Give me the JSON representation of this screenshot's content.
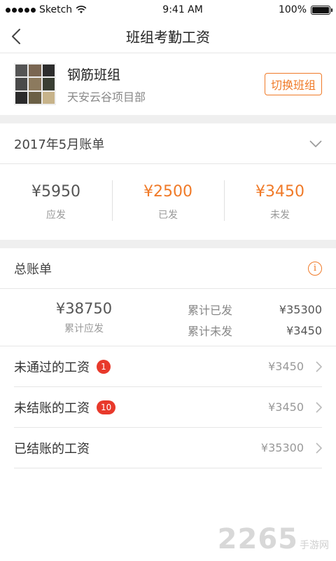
{
  "status": {
    "carrier": "Sketch",
    "time": "9:41 AM",
    "battery": "100%"
  },
  "nav": {
    "title": "班组考勤工资"
  },
  "team": {
    "name": "钢筋班组",
    "project": "天安云谷项目部",
    "switch_label": "切换班组"
  },
  "month": {
    "label": "2017年5月账单"
  },
  "stats": [
    {
      "value": "¥5950",
      "label": "应发",
      "color": "#555555"
    },
    {
      "value": "¥2500",
      "label": "已发",
      "color": "#f07a28"
    },
    {
      "value": "¥3450",
      "label": "未发",
      "color": "#f07a28"
    }
  ],
  "total": {
    "title": "总账单",
    "amount": "¥38750",
    "amount_label": "累计应发",
    "paid_label": "累计已发",
    "paid_value": "¥35300",
    "unpaid_label": "累计未发",
    "unpaid_value": "¥3450"
  },
  "list": [
    {
      "label": "未通过的工资",
      "badge": "1",
      "amount": "¥3450"
    },
    {
      "label": "未结账的工资",
      "badge": "10",
      "amount": "¥3450"
    },
    {
      "label": "已结账的工资",
      "amount": "¥35300"
    }
  ],
  "watermark": {
    "big": "2265",
    "small": "手游网"
  },
  "colors": {
    "accent": "#f07a28",
    "badge": "#e8392b"
  },
  "icons": [
    "back-icon",
    "wifi-icon",
    "battery-icon",
    "chevron-down-icon",
    "info-icon",
    "chevron-right-icon"
  ]
}
